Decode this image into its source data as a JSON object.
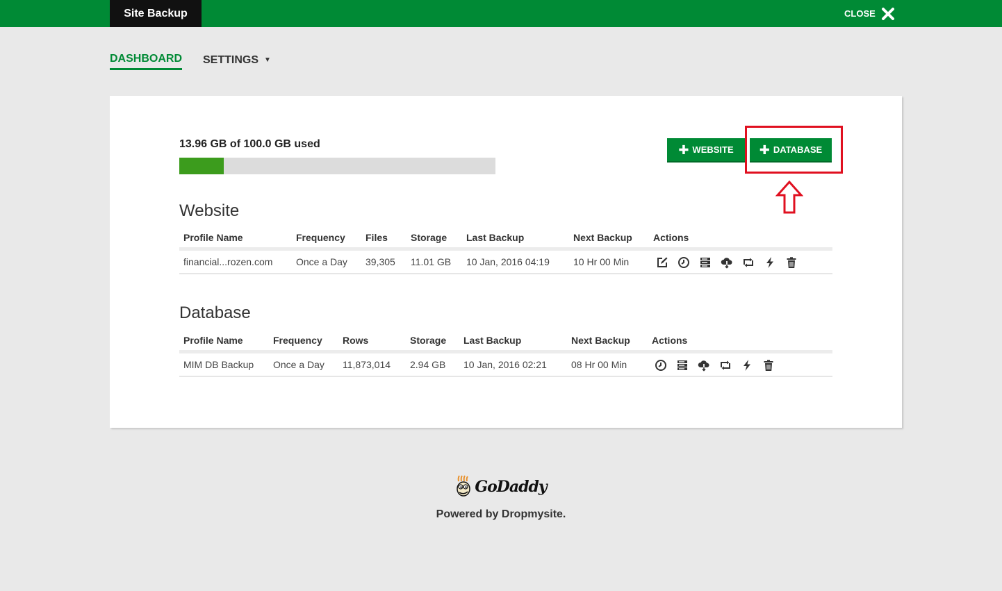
{
  "header": {
    "app_title": "Site Backup",
    "close_label": "CLOSE"
  },
  "nav": {
    "tabs": [
      {
        "label": "DASHBOARD"
      },
      {
        "label": "SETTINGS"
      }
    ]
  },
  "usage": {
    "text": "13.96 GB of 100.0 GB used",
    "used_gb": 13.96,
    "total_gb": 100.0,
    "fill_fraction": 0.14
  },
  "buttons": {
    "website": "WEBSITE",
    "database": "DATABASE"
  },
  "website": {
    "title": "Website",
    "columns": [
      "Profile Name",
      "Frequency",
      "Files",
      "Storage",
      "Last Backup",
      "Next Backup",
      "Actions"
    ],
    "rows": [
      {
        "profile": "financial...rozen.com",
        "frequency": "Once a Day",
        "files": "39,305",
        "storage": "11.01 GB",
        "last_backup": "10 Jan, 2016 04:19",
        "next_backup": "10 Hr 00 Min"
      }
    ],
    "action_icons": [
      "edit-icon",
      "clock-icon",
      "server-icon",
      "cloud-download-icon",
      "sync-icon",
      "bolt-icon",
      "trash-icon"
    ]
  },
  "database": {
    "title": "Database",
    "columns": [
      "Profile Name",
      "Frequency",
      "Rows",
      "Storage",
      "Last Backup",
      "Next Backup",
      "Actions"
    ],
    "rows": [
      {
        "profile": "MIM DB Backup",
        "frequency": "Once a Day",
        "rows": "11,873,014",
        "storage": "2.94 GB",
        "last_backup": "10 Jan, 2016 02:21",
        "next_backup": "08 Hr 00 Min"
      }
    ],
    "action_icons": [
      "clock-icon",
      "server-icon",
      "cloud-download-icon",
      "sync-icon",
      "bolt-icon",
      "trash-icon"
    ]
  },
  "footer": {
    "logo_text": "GoDaddy",
    "powered_by": "Powered by Dropmysite."
  },
  "colors": {
    "brand_green": "#008a35",
    "usage_fill": "#3c9c1d",
    "highlight_red": "#e01020",
    "header_black": "#111111"
  }
}
